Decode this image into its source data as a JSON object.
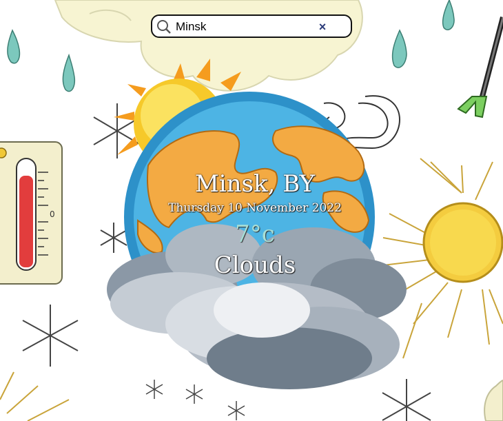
{
  "search": {
    "value": "Minsk",
    "icon": "search-icon",
    "clear_label": "×"
  },
  "weather": {
    "location": "Minsk, BY",
    "date": "Thursday 10 November 2022",
    "temperature": "7°c",
    "condition": "Clouds"
  },
  "background": {
    "description_icons": [
      "raindrop-icon",
      "cloud-icon",
      "sun-icon",
      "thermometer-icon",
      "snowflake-icon",
      "wind-icon",
      "globe-icon",
      "storm-cloud-icon",
      "umbrella-icon"
    ]
  }
}
